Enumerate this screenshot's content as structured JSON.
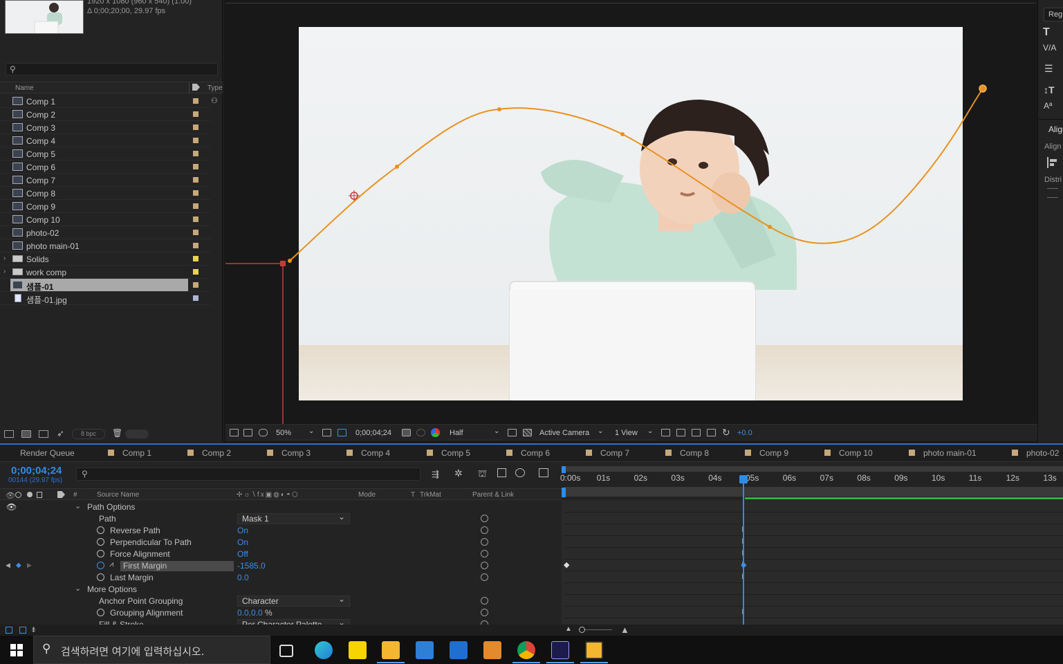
{
  "project": {
    "info_line1": "1920 x 1080  (960 x 540) (1.00)",
    "info_line2": "Δ 0;00;20;00, 29.97 fps",
    "search_placeholder": "",
    "col_name": "Name",
    "col_type": "Type",
    "items": [
      {
        "label": "Comp 1",
        "kind": "comp",
        "color": "#c7a87a"
      },
      {
        "label": "Comp 2",
        "kind": "comp",
        "color": "#c7a87a"
      },
      {
        "label": "Comp 3",
        "kind": "comp",
        "color": "#c7a87a"
      },
      {
        "label": "Comp 4",
        "kind": "comp",
        "color": "#c7a87a"
      },
      {
        "label": "Comp 5",
        "kind": "comp",
        "color": "#c7a87a"
      },
      {
        "label": "Comp 6",
        "kind": "comp",
        "color": "#c7a87a"
      },
      {
        "label": "Comp 7",
        "kind": "comp",
        "color": "#c7a87a"
      },
      {
        "label": "Comp 8",
        "kind": "comp",
        "color": "#c7a87a"
      },
      {
        "label": "Comp 9",
        "kind": "comp",
        "color": "#c7a87a"
      },
      {
        "label": "Comp 10",
        "kind": "comp",
        "color": "#c7a87a"
      },
      {
        "label": "photo-02",
        "kind": "comp",
        "color": "#c7a87a"
      },
      {
        "label": "photo main-01",
        "kind": "comp",
        "color": "#c7a87a"
      },
      {
        "label": "Solids",
        "kind": "folder",
        "color": "#e8d44d"
      },
      {
        "label": "work comp",
        "kind": "folder",
        "color": "#e8d44d"
      },
      {
        "label": "샘플-01",
        "kind": "comp",
        "color": "#c7a87a"
      },
      {
        "label": "샘플-01.jpg",
        "kind": "file",
        "color": "#a9b4d6"
      }
    ],
    "bpc": "8 bpc"
  },
  "viewer": {
    "zoom": "50%",
    "timecode": "0;00;04;24",
    "resolution": "Half",
    "camera": "Active Camera",
    "views": "1 View",
    "exposure": "+0.0"
  },
  "right_panel": {
    "font_style": "Reg",
    "align_title": "Align",
    "align_label": "Align",
    "distribute_label": "Distri"
  },
  "timeline": {
    "tabs": [
      "Render Queue",
      "Comp 1",
      "Comp 2",
      "Comp 3",
      "Comp 4",
      "Comp 5",
      "Comp 6",
      "Comp 7",
      "Comp 8",
      "Comp 9",
      "Comp 10",
      "photo main-01",
      "photo-02"
    ],
    "timecode": "0;00;04;24",
    "frames": "00144 (29.97 fps)",
    "col_source_name": "Source Name",
    "col_mode": "Mode",
    "col_t": "T",
    "col_trkmat": "TrkMat",
    "col_parent": "Parent & Link",
    "col_num": "#",
    "rows": [
      {
        "name": "Path Options",
        "level": 0,
        "twisty": "⌄"
      },
      {
        "name": "Path",
        "level": 1,
        "dropdown": "Mask 1"
      },
      {
        "name": "Reverse Path",
        "level": 2,
        "value": "On"
      },
      {
        "name": "Perpendicular To Path",
        "level": 2,
        "value": "On"
      },
      {
        "name": "Force Alignment",
        "level": 2,
        "value": "Off"
      },
      {
        "name": "First Margin",
        "level": 2,
        "value": "-1585.0",
        "selected": true
      },
      {
        "name": "Last Margin",
        "level": 2,
        "value": "0.0"
      },
      {
        "name": "More Options",
        "level": 0,
        "twisty": "⌄"
      },
      {
        "name": "Anchor Point Grouping",
        "level": 1,
        "dropdown": "Character"
      },
      {
        "name": "Grouping Alignment",
        "level": 2,
        "value": "0.0,0.0",
        "unit": "%"
      },
      {
        "name": "Fill & Stroke",
        "level": 1,
        "dropdown": "Per Character Palette"
      }
    ],
    "ruler_ticks": [
      "0:00s",
      "01s",
      "02s",
      "03s",
      "04s",
      "05s",
      "06s",
      "07s",
      "08s",
      "09s",
      "10s",
      "11s",
      "12s",
      "13s"
    ],
    "current_time_seconds": 4.8
  },
  "taskbar": {
    "search_placeholder": "검색하려면 여기에 입력하십시오.",
    "apps": [
      "task-view",
      "edge",
      "kakaotalk",
      "file-explorer",
      "store",
      "mail",
      "video-editor",
      "chrome",
      "after-effects",
      "crop-tool"
    ]
  }
}
